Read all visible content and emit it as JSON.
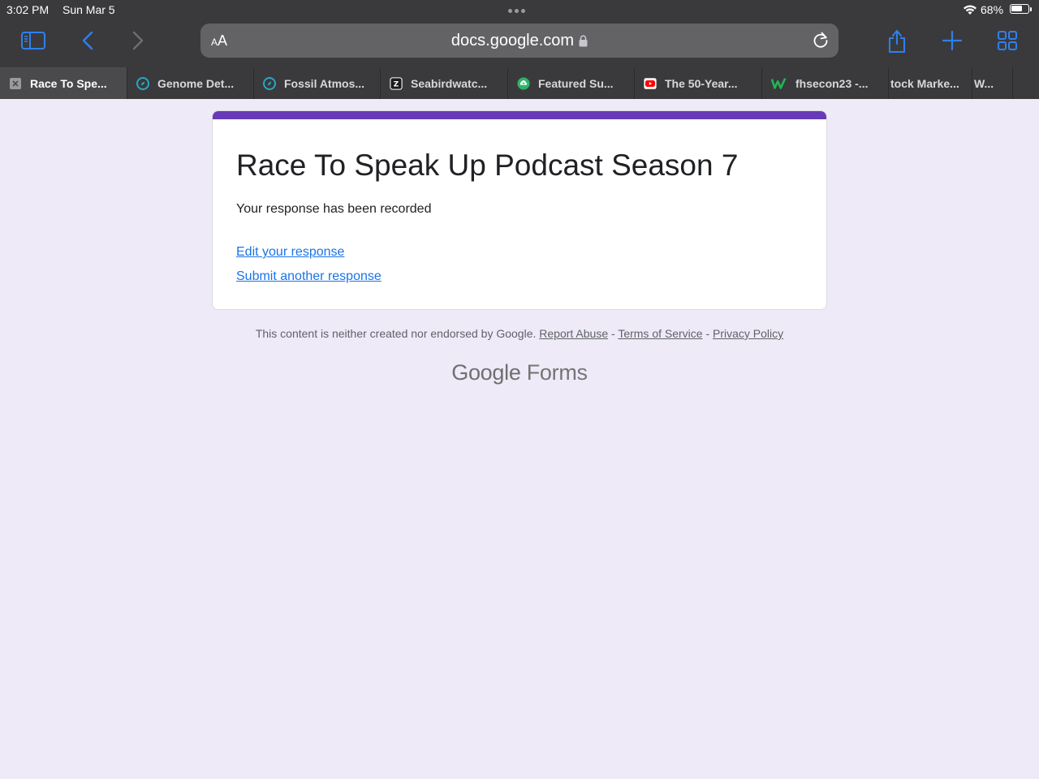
{
  "status": {
    "time": "3:02 PM",
    "date": "Sun Mar 5",
    "battery_pct": "68%",
    "battery_level": 0.68
  },
  "toolbar": {
    "text_size_label_small": "A",
    "text_size_label_large": "A",
    "url": "docs.google.com",
    "accent_color": "#2f80ed"
  },
  "tabs": [
    {
      "label": "Race To Spe...",
      "icon": "close-icon",
      "active": true
    },
    {
      "label": "Genome Det...",
      "icon": "compass-icon"
    },
    {
      "label": "Fossil Atmos...",
      "icon": "compass-icon"
    },
    {
      "label": "Seabirdwatc...",
      "icon": "z-icon"
    },
    {
      "label": "Featured Su...",
      "icon": "upload-cloud-icon"
    },
    {
      "label": "The 50-Year...",
      "icon": "youtube-icon"
    },
    {
      "label": "fhsecon23 -...",
      "icon": "w-logo-icon"
    },
    {
      "label": "tock Marke...",
      "icon": ""
    },
    {
      "label": "W...",
      "icon": ""
    }
  ],
  "form": {
    "title": "Race To Speak Up Podcast Season 7",
    "message": "Your response has been recorded",
    "edit_link": "Edit your response",
    "another_link": "Submit another response",
    "accent_color": "#673ab7"
  },
  "footer": {
    "disclaimer": "This content is neither created nor endorsed by Google.",
    "report_abuse": "Report Abuse",
    "sep1": " - ",
    "terms": "Terms of Service",
    "sep2": " - ",
    "privacy": "Privacy Policy",
    "brand_google": "Google",
    "brand_forms": "Forms"
  }
}
